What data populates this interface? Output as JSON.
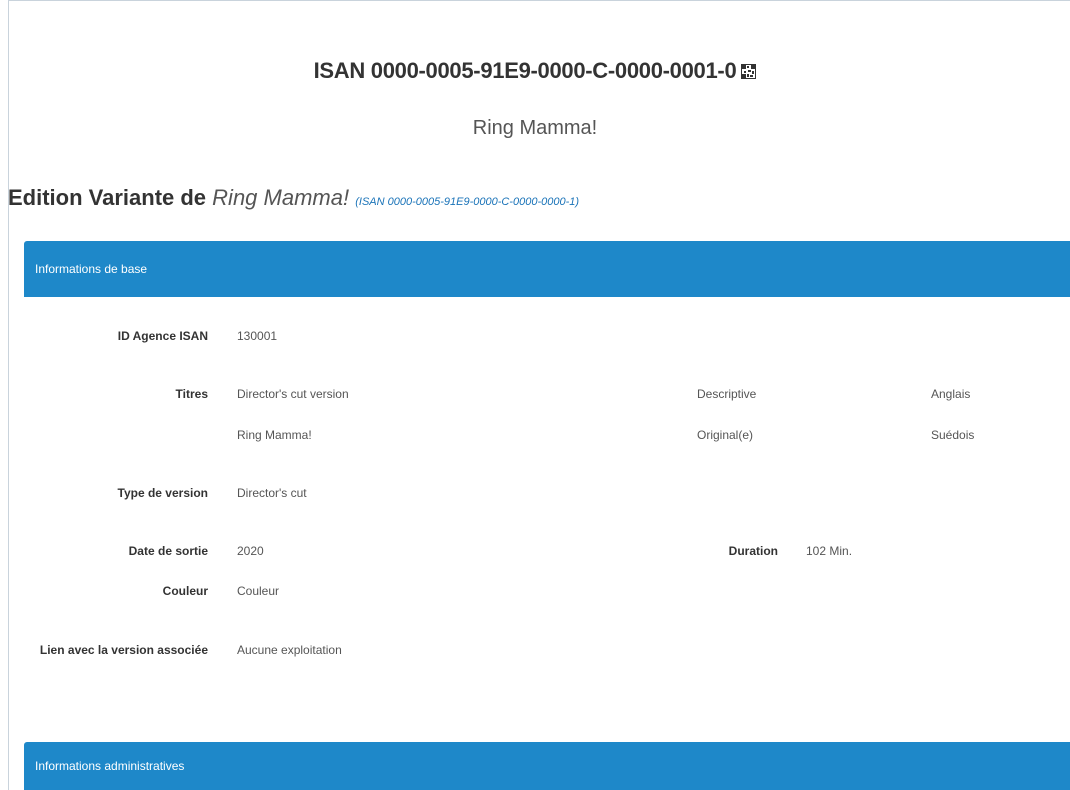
{
  "header": {
    "isan": "ISAN 0000-0005-91E9-0000-C-0000-0001-0",
    "title": "Ring Mamma!"
  },
  "edition": {
    "label": "Edition Variante de",
    "parent_title": "Ring Mamma!",
    "parent_isan_link": "(ISAN 0000-0005-91E9-0000-C-0000-0000-1)"
  },
  "panels": {
    "base_title": "Informations de base",
    "admin_title": "Informations administratives"
  },
  "fields": {
    "agency_id": {
      "label": "ID Agence ISAN",
      "value": "130001"
    },
    "titles": {
      "label": "Titres",
      "rows": [
        {
          "title": "Director's cut version",
          "type": "Descriptive",
          "language": "Anglais"
        },
        {
          "title": "Ring Mamma!",
          "type": "Original(e)",
          "language": "Suédois"
        }
      ]
    },
    "version_type": {
      "label": "Type de version",
      "value": "Director's cut"
    },
    "release_date": {
      "label": "Date de sortie",
      "value": "2020"
    },
    "duration": {
      "label": "Duration",
      "value": "102 Min."
    },
    "colour": {
      "label": "Couleur",
      "value": "Couleur"
    },
    "link": {
      "label": "Lien avec la version associée",
      "value": "Aucune exploitation"
    }
  }
}
